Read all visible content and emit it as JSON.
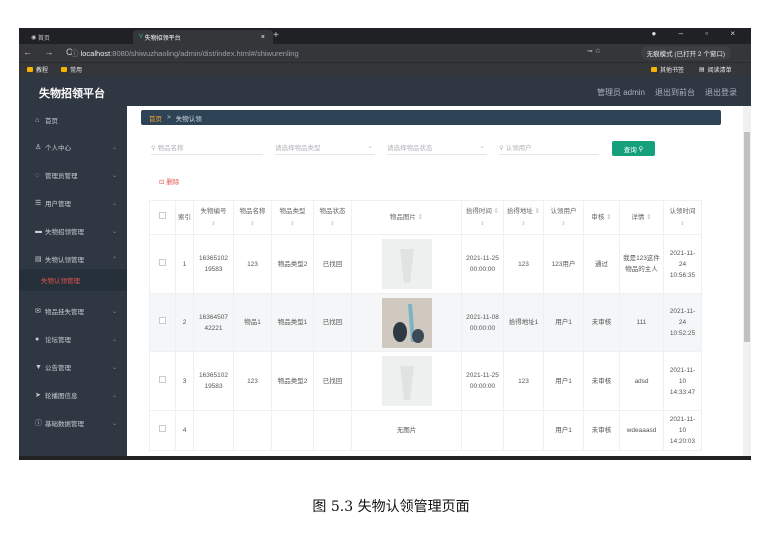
{
  "browser": {
    "tab1": "首页",
    "tab2": "失物招领平台",
    "url_host": "localhost",
    "url_path": ":8080/shiwuzhaoling/admin/dist/index.html#/shiwurenling",
    "incognito": "无痕模式 (已打开 2 个窗口)",
    "bookmarks": [
      "教程",
      "常用"
    ],
    "bookmarks_right": [
      "其他书签",
      "阅读清单"
    ]
  },
  "header": {
    "title": "失物招领平台",
    "user": "管理员 admin",
    "back": "退出到前台",
    "logout": "退出登录"
  },
  "sidebar": {
    "items": [
      {
        "label": "首页",
        "icon": "home-icon"
      },
      {
        "label": "个人中心",
        "icon": "user-icon"
      },
      {
        "label": "管理员管理",
        "icon": "admin-icon"
      },
      {
        "label": "用户管理",
        "icon": "users-icon"
      },
      {
        "label": "失物招领管理",
        "icon": "box-icon"
      },
      {
        "label": "失物认领管理",
        "icon": "document-icon"
      },
      {
        "label": "失物认领管理",
        "icon": ""
      },
      {
        "label": "物品挂失管理",
        "icon": "mail-icon"
      },
      {
        "label": "论坛管理",
        "icon": "forum-icon"
      },
      {
        "label": "公告管理",
        "icon": "notice-icon"
      },
      {
        "label": "轮播图信息",
        "icon": "send-icon"
      },
      {
        "label": "基础数据管理",
        "icon": "info-icon"
      }
    ]
  },
  "breadcrumb": {
    "home": "首页",
    "sep": ">",
    "current": "失物认领"
  },
  "filters": {
    "name_placeholder": "物品名称",
    "type_placeholder": "请选择物品类型",
    "status_placeholder": "请选择物品状态",
    "user_placeholder": "认领用户",
    "query_label": "查询"
  },
  "actions": {
    "delete_label": "删除"
  },
  "table": {
    "headers": [
      "索引",
      "失物编号",
      "物品名称",
      "物品类型",
      "物品状态",
      "物品图片",
      "拾得时间",
      "拾得地址",
      "认领用户",
      "审核",
      "详情",
      "认领时间"
    ],
    "rows": [
      {
        "idx": "1",
        "code": "1636510219583",
        "name": "123",
        "type": "物品类型2",
        "status": "已找回",
        "pic": "image",
        "time": "2021-11-25 00:00:00",
        "addr": "123",
        "user": "123用户",
        "audit": "通过",
        "detail": "我是123这件物品的主人",
        "claim": "2021-11-24 10:56:35"
      },
      {
        "idx": "2",
        "code": "1636450742221",
        "name": "物品1",
        "type": "物品类型1",
        "status": "已找回",
        "pic": "image",
        "time": "2021-11-08 00:00:00",
        "addr": "拾得地址1",
        "user": "用户1",
        "audit": "未审核",
        "detail": "111",
        "claim": "2021-11-24 10:52:25"
      },
      {
        "idx": "3",
        "code": "1636510219583",
        "name": "123",
        "type": "物品类型2",
        "status": "已找回",
        "pic": "image",
        "time": "2021-11-25 00:00:00",
        "addr": "123",
        "user": "用户1",
        "audit": "未审核",
        "detail": "adsd",
        "claim": "2021-11-10 14:33:47"
      },
      {
        "idx": "4",
        "code": "",
        "name": "",
        "type": "",
        "status": "",
        "pic": "无图片",
        "time": "",
        "addr": "",
        "user": "用户1",
        "audit": "未审核",
        "detail": "wdeaaasd",
        "claim": "2021-11-10 14:20:03"
      }
    ]
  },
  "caption": "图 5.3  失物认领管理页面"
}
